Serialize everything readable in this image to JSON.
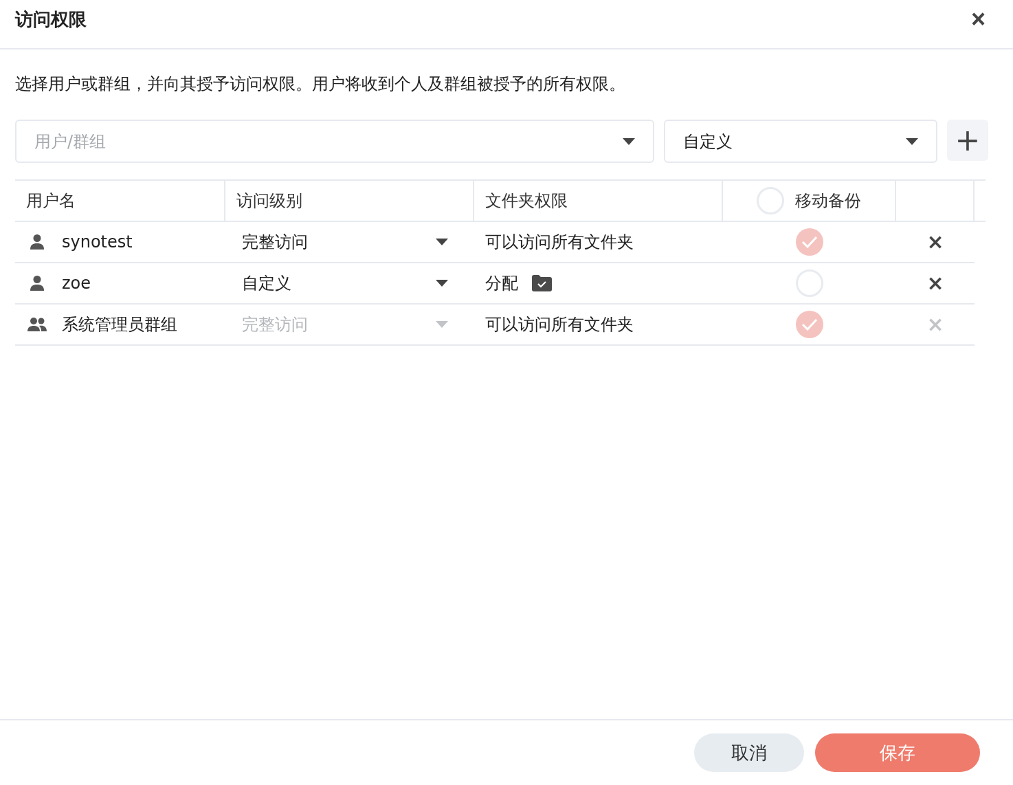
{
  "dialog": {
    "title": "访问权限",
    "close": "×"
  },
  "description": "选择用户或群组，并向其授予访问权限。用户将收到个人及群组被授予的所有权限。",
  "user_select": {
    "placeholder": "用户/群组"
  },
  "level_select": {
    "value": "自定义"
  },
  "add_button": {
    "label": "+"
  },
  "table": {
    "columns": [
      "用户名",
      "访问级别",
      "文件夹权限",
      "移动备份"
    ],
    "header_backup_checked": false,
    "rows": [
      {
        "kind": "user",
        "name": "synotest",
        "level": "完整访问",
        "disabled": false,
        "folder": "可以访问所有文件夹",
        "folder_icon": false,
        "backup": true,
        "remove": "×"
      },
      {
        "kind": "user",
        "name": "zoe",
        "level": "自定义",
        "disabled": false,
        "folder": "分配",
        "folder_icon": true,
        "backup": false,
        "remove": "×"
      },
      {
        "kind": "group",
        "name": "系统管理员群组",
        "level": "完整访问",
        "disabled": true,
        "folder": "可以访问所有文件夹",
        "folder_icon": false,
        "backup": true,
        "remove": "×"
      }
    ]
  },
  "buttons": [
    {
      "label": "取消",
      "kind": "secondary"
    },
    {
      "label": "保存",
      "kind": "primary"
    }
  ]
}
